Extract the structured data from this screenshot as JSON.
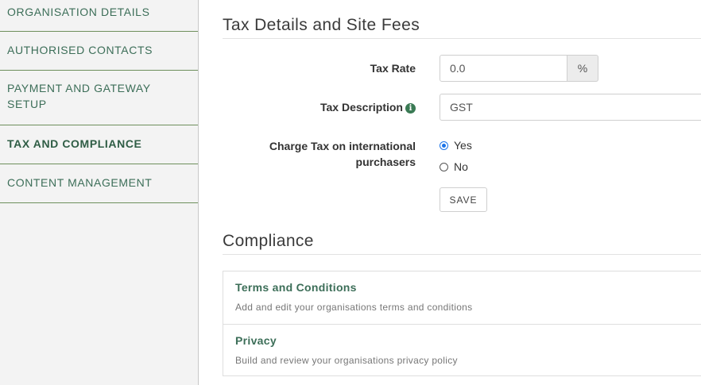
{
  "sidebar": {
    "items": [
      {
        "label": "ORGANISATION DETAILS",
        "active": false
      },
      {
        "label": "AUTHORISED CONTACTS",
        "active": false
      },
      {
        "label_line1": "PAYMENT AND GATEWAY",
        "label_line2": "SETUP",
        "active": false
      },
      {
        "label": "TAX AND COMPLIANCE",
        "active": true
      },
      {
        "label": "CONTENT MANAGEMENT",
        "active": false
      }
    ]
  },
  "tax_section": {
    "title": "Tax Details and Site Fees",
    "tax_rate": {
      "label": "Tax Rate",
      "value": "0.0",
      "addon": "%"
    },
    "tax_description": {
      "label": "Tax Description",
      "value": "GST",
      "icon": "info-icon"
    },
    "charge_tax": {
      "label_line1": "Charge Tax on international",
      "label_line2": "purchasers",
      "options": [
        {
          "label": "Yes",
          "checked": true
        },
        {
          "label": "No",
          "checked": false
        }
      ]
    },
    "save_label": "SAVE"
  },
  "compliance": {
    "title": "Compliance",
    "items": [
      {
        "title": "Terms and Conditions",
        "description": "Add and edit your organisations terms and conditions"
      },
      {
        "title": "Privacy",
        "description": "Build and review your organisations privacy policy"
      }
    ]
  },
  "colors": {
    "accent_green": "#3c6e58",
    "radio_blue": "#1a73e8"
  }
}
